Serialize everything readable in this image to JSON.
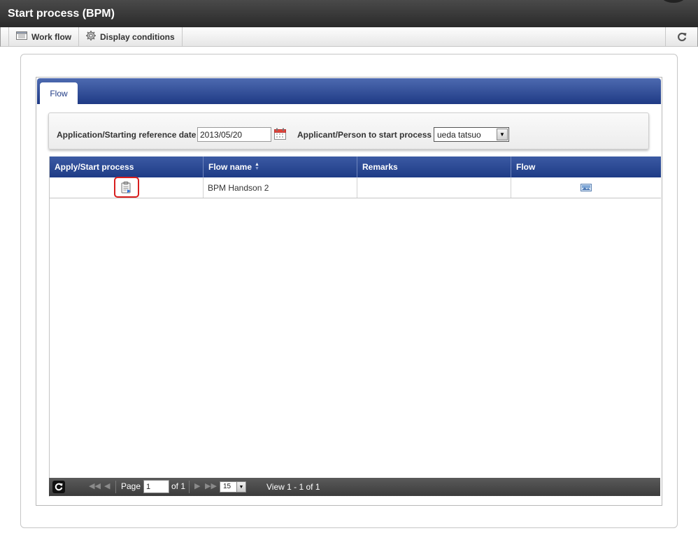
{
  "window": {
    "title": "Start process (BPM)"
  },
  "toolbar": {
    "workflow_label": "Work flow",
    "display_conditions_label": "Display conditions"
  },
  "tabs": [
    {
      "label": "Flow"
    }
  ],
  "conditions": {
    "date_label": "Application/Starting reference date",
    "date_value": "2013/05/20",
    "applicant_label": "Applicant/Person to start process",
    "applicant_value": "ueda tatsuo"
  },
  "grid": {
    "columns": [
      "Apply/Start process",
      "Flow name",
      "Remarks",
      "Flow"
    ],
    "sorted_column": "Flow name",
    "rows": [
      {
        "flow_name": "BPM Handson 2",
        "remarks": ""
      }
    ]
  },
  "pager": {
    "page_label": "Page",
    "page_value": "1",
    "of_label": "of 1",
    "rows_per_page": "15",
    "view_text": "View 1 - 1 of 1"
  },
  "colors": {
    "header_blue": "#1e3b86",
    "highlight_red": "#d81e1e",
    "titlebar": "#2a2a2a"
  },
  "icons": {
    "workflow": "list-icon",
    "display_conditions": "gear-icon",
    "refresh": "refresh-icon",
    "calendar": "calendar-icon",
    "apply": "clipboard-icon",
    "flow": "image-icon"
  }
}
